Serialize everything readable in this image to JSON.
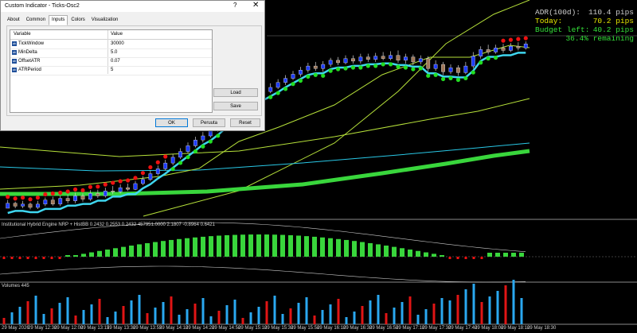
{
  "dialog": {
    "title": "Custom Indicator - Ticks-Osc2",
    "help": "?",
    "close": "✕",
    "tabs": [
      "About",
      "Common",
      "Inputs",
      "Colors",
      "Visualization"
    ],
    "active_tab": "Inputs",
    "table": {
      "col_variable": "Variable",
      "col_value": "Value",
      "rows": [
        {
          "name": "TickWindow",
          "value": "30000",
          "icon": "abc-icon"
        },
        {
          "name": "MinDelta",
          "value": "5.0",
          "icon": "abc-icon"
        },
        {
          "name": "OffsetATR",
          "value": "0.07",
          "icon": "abc-icon"
        },
        {
          "name": "ATRPeriod",
          "value": "5",
          "icon": "abc-icon"
        }
      ]
    },
    "buttons": {
      "load": "Load",
      "save": "Save",
      "ok": "OK",
      "reset_one": "Peruuta",
      "reset": "Reset"
    }
  },
  "adr_panel": [
    {
      "label": "ADR(100d):",
      "value": "110.4 pips",
      "color": "#cfcfcf"
    },
    {
      "label": "Today:",
      "value": "70.2 pips",
      "color": "#e8e800"
    },
    {
      "label": "Budget left:",
      "value": "40.2 pips",
      "color": "#35e03a"
    },
    {
      "label": "",
      "value": "36.4% remaining",
      "color": "#35e03a"
    }
  ],
  "subwindows": {
    "osc_label": "Institutional Hybrid Engine NRP + HistBB 0.2432 0.2553 0.2432 457951.0000 2.1807 -0.8964 0.6421",
    "volume_label": "Volumes 445"
  },
  "time_axis": [
    "29 May 2026",
    "29 May 12:30",
    "29 May 12:00",
    "29 May 13:15",
    "29 May 13:30",
    "29 May 13:55",
    "29 May 14:10",
    "29 May 14:20",
    "29 May 14:50",
    "29 May 15:10",
    "29 May 15:30",
    "29 May 15:50",
    "29 May 16:10",
    "29 May 16:30",
    "29 May 16:50",
    "29 May 17:10",
    "29 May 17:30",
    "29 May 17:40",
    "29 May 18:00",
    "29 May 18:10",
    "29 May 18:30"
  ],
  "colors": {
    "bg": "#000000",
    "bull": "#1e3cff",
    "bear": "#a0785a",
    "bull_dot": "#22dd22",
    "bear_dot": "#ee1111",
    "signal": "#3fd6ef",
    "ma_band": "#b6e13a",
    "ma_thick": "#39d63c",
    "ma_cyan": "#29c8e6",
    "volume_up": "#2aa8f0",
    "volume_down": "#e01515"
  },
  "chart_data": {
    "type": "candlestick",
    "candles": [
      [
        0,
        0.12,
        0.2,
        0.02,
        0.12
      ],
      [
        0.12,
        0.05,
        0.16,
        0,
        0.1
      ],
      [
        0.05,
        0.1,
        0.18,
        0,
        0.14
      ],
      [
        0.1,
        0.02,
        0.14,
        -0.03,
        0.08
      ],
      [
        0.02,
        0.1,
        0.18,
        -0.02,
        0.15
      ],
      [
        0.1,
        0.2,
        0.26,
        0.05,
        0.22
      ],
      [
        0.2,
        0.1,
        0.28,
        0.06,
        0.25
      ],
      [
        0.1,
        0.24,
        0.3,
        0.05,
        0.28
      ],
      [
        0.24,
        0.18,
        0.33,
        0.12,
        0.3
      ],
      [
        0.18,
        0.3,
        0.38,
        0.12,
        0.35
      ],
      [
        0.3,
        0.22,
        0.36,
        0.16,
        0.34
      ],
      [
        0.22,
        0.36,
        0.44,
        0.18,
        0.42
      ],
      [
        0.36,
        0.3,
        0.45,
        0.25,
        0.42
      ],
      [
        0.3,
        0.42,
        0.5,
        0.26,
        0.47
      ],
      [
        0.42,
        0.4,
        0.54,
        0.34,
        0.5
      ],
      [
        0.4,
        0.5,
        0.58,
        0.36,
        0.55
      ],
      [
        0.5,
        0.46,
        0.6,
        0.42,
        0.56
      ],
      [
        0.46,
        0.6,
        0.66,
        0.44,
        0.64
      ],
      [
        0.6,
        0.7,
        0.78,
        0.56,
        0.76
      ],
      [
        0.7,
        0.84,
        0.92,
        0.66,
        0.88
      ],
      [
        0.84,
        0.96,
        1.04,
        0.8,
        1.0
      ],
      [
        0.96,
        1.1,
        1.18,
        0.92,
        1.14
      ],
      [
        1.1,
        1.24,
        1.32,
        1.05,
        1.28
      ],
      [
        1.24,
        1.38,
        1.46,
        1.2,
        1.42
      ],
      [
        1.38,
        1.52,
        1.6,
        1.34,
        1.56
      ],
      [
        1.52,
        1.66,
        1.74,
        1.48,
        1.7
      ],
      [
        1.66,
        1.76,
        1.86,
        1.6,
        1.8
      ],
      [
        1.76,
        1.9,
        1.98,
        1.72,
        1.94
      ],
      [
        1.9,
        2.06,
        2.14,
        1.86,
        2.1
      ],
      [
        2.06,
        2.2,
        2.28,
        2.02,
        2.24
      ],
      [
        2.2,
        2.32,
        2.42,
        2.16,
        2.38
      ],
      [
        2.32,
        2.46,
        2.54,
        2.28,
        2.5
      ],
      [
        2.46,
        2.6,
        2.68,
        2.42,
        2.64
      ],
      [
        2.6,
        2.74,
        2.82,
        2.56,
        2.78
      ],
      [
        2.74,
        2.84,
        2.94,
        2.7,
        2.9
      ],
      [
        2.84,
        2.94,
        3.04,
        2.8,
        3.0
      ],
      [
        2.94,
        3.06,
        3.14,
        2.9,
        3.1
      ],
      [
        3.06,
        3.16,
        3.24,
        3.0,
        3.2
      ],
      [
        3.16,
        3.26,
        3.34,
        3.12,
        3.3
      ],
      [
        3.26,
        3.36,
        3.44,
        3.2,
        3.4
      ],
      [
        3.36,
        3.46,
        3.54,
        3.3,
        3.5
      ],
      [
        3.46,
        3.4,
        3.56,
        3.34,
        3.46
      ],
      [
        3.4,
        3.5,
        3.58,
        3.32,
        3.55
      ],
      [
        3.5,
        3.6,
        3.66,
        3.44,
        3.64
      ],
      [
        3.6,
        3.54,
        3.68,
        3.48,
        3.62
      ],
      [
        3.54,
        3.64,
        3.72,
        3.5,
        3.7
      ],
      [
        3.64,
        3.58,
        3.72,
        3.52,
        3.68
      ],
      [
        3.58,
        3.68,
        3.76,
        3.52,
        3.74
      ],
      [
        3.68,
        3.62,
        3.76,
        3.56,
        3.72
      ],
      [
        3.62,
        3.7,
        3.78,
        3.56,
        3.76
      ],
      [
        3.7,
        3.64,
        3.8,
        3.6,
        3.78
      ],
      [
        3.64,
        3.72,
        3.82,
        3.6,
        3.8
      ],
      [
        3.72,
        3.6,
        3.84,
        3.54,
        3.78
      ],
      [
        3.6,
        3.68,
        3.76,
        3.52,
        3.74
      ],
      [
        3.68,
        3.56,
        3.74,
        3.48,
        3.7
      ],
      [
        3.56,
        3.64,
        3.72,
        3.5,
        3.7
      ],
      [
        3.64,
        3.4,
        3.7,
        3.32,
        3.68
      ],
      [
        3.4,
        3.5,
        3.6,
        3.34,
        3.56
      ],
      [
        3.5,
        3.32,
        3.56,
        3.24,
        3.52
      ],
      [
        3.32,
        3.42,
        3.5,
        3.26,
        3.48
      ],
      [
        3.42,
        3.3,
        3.48,
        3.22,
        3.46
      ],
      [
        3.3,
        3.46,
        3.56,
        3.26,
        3.52
      ],
      [
        3.46,
        3.7,
        3.8,
        3.4,
        3.76
      ],
      [
        3.7,
        3.86,
        3.94,
        3.64,
        3.9
      ],
      [
        3.86,
        3.8,
        3.98,
        3.74,
        3.94
      ],
      [
        3.8,
        3.9,
        3.98,
        3.76,
        3.96
      ],
      [
        3.9,
        3.84,
        4.0,
        3.78,
        3.98
      ],
      [
        3.84,
        3.94,
        4.02,
        3.8,
        4.0
      ],
      [
        3.94,
        3.9,
        4.04,
        3.84,
        4.02
      ],
      [
        3.9,
        4.0,
        4.06,
        3.86,
        4.04
      ]
    ]
  }
}
